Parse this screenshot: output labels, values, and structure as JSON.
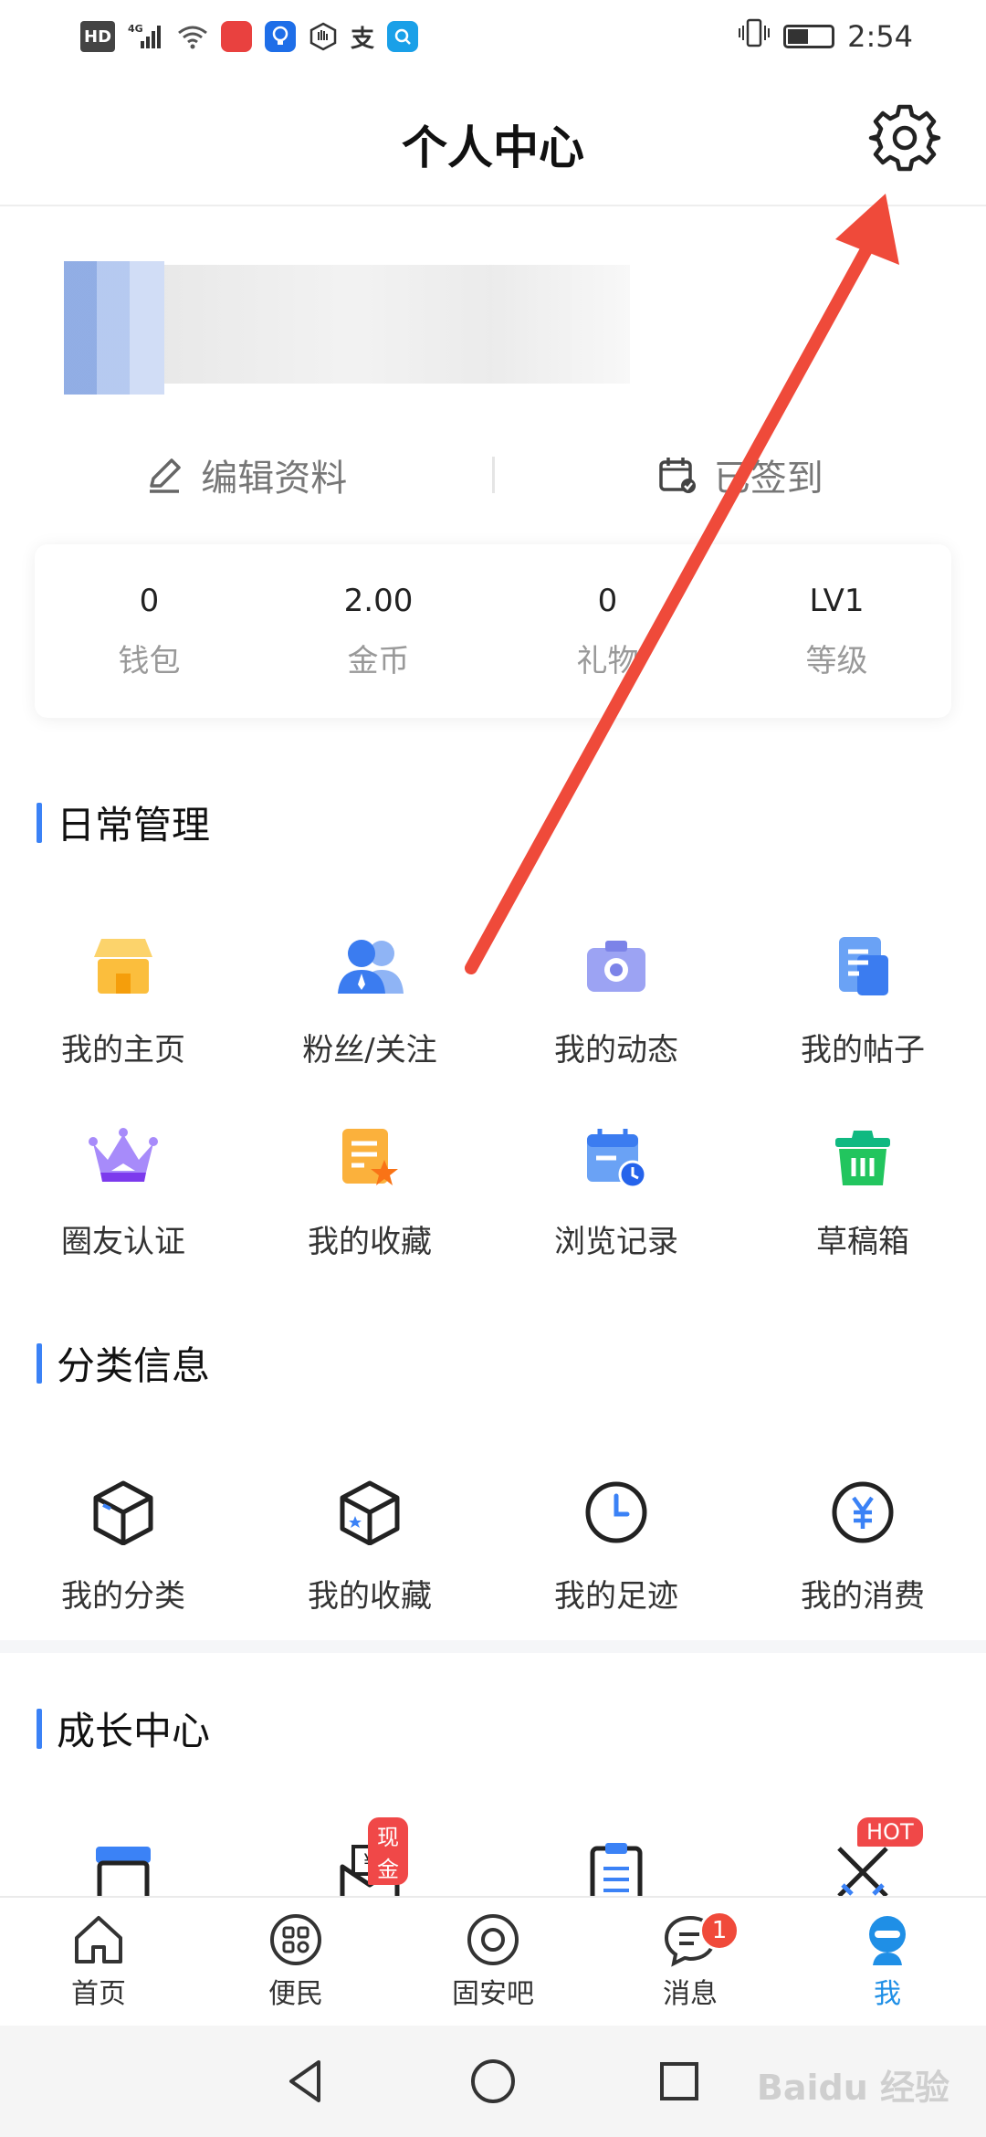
{
  "status_bar": {
    "left_text": "HD",
    "network": "4G",
    "time": "2:54"
  },
  "header": {
    "title": "个人中心",
    "settings_icon": "gear-icon"
  },
  "profile": {
    "edit_label": "编辑资料",
    "signed_label": "已签到"
  },
  "stats": [
    {
      "value": "0",
      "label": "钱包"
    },
    {
      "value": "2.00",
      "label": "金币"
    },
    {
      "value": "0",
      "label": "礼物"
    },
    {
      "value": "LV1",
      "label": "等级"
    }
  ],
  "daily": {
    "title": "日常管理",
    "items": [
      {
        "label": "我的主页",
        "icon": "shop-icon"
      },
      {
        "label": "粉丝/关注",
        "icon": "users-icon"
      },
      {
        "label": "我的动态",
        "icon": "camera-icon"
      },
      {
        "label": "我的帖子",
        "icon": "document-icon"
      },
      {
        "label": "圈友认证",
        "icon": "crown-icon"
      },
      {
        "label": "我的收藏",
        "icon": "favorite-note-icon"
      },
      {
        "label": "浏览记录",
        "icon": "calendar-clock-icon"
      },
      {
        "label": "草稿箱",
        "icon": "trash-box-icon"
      }
    ]
  },
  "category": {
    "title": "分类信息",
    "items": [
      {
        "label": "我的分类",
        "icon": "cube-icon"
      },
      {
        "label": "我的收藏",
        "icon": "cube-star-icon"
      },
      {
        "label": "我的足迹",
        "icon": "clock-icon"
      },
      {
        "label": "我的消费",
        "icon": "yuan-icon"
      }
    ]
  },
  "growth": {
    "title": "成长中心",
    "items": [
      {
        "icon": "store-icon",
        "tag": ""
      },
      {
        "icon": "cash-envelope-icon",
        "tag": "现金"
      },
      {
        "icon": "clipboard-icon",
        "tag": ""
      },
      {
        "icon": "swords-icon",
        "tag": "HOT"
      }
    ]
  },
  "tabs": [
    {
      "label": "首页",
      "icon": "home-icon"
    },
    {
      "label": "便民",
      "icon": "grid-icon"
    },
    {
      "label": "固安吧",
      "icon": "target-icon"
    },
    {
      "label": "消息",
      "icon": "chat-icon",
      "badge": "1"
    },
    {
      "label": "我",
      "icon": "profile-icon"
    }
  ],
  "colors": {
    "accent": "#1f8fe6",
    "section_bar": "#3b82f6",
    "annotation_arrow": "#ef4a3a"
  },
  "watermark": "Baidu 经验"
}
